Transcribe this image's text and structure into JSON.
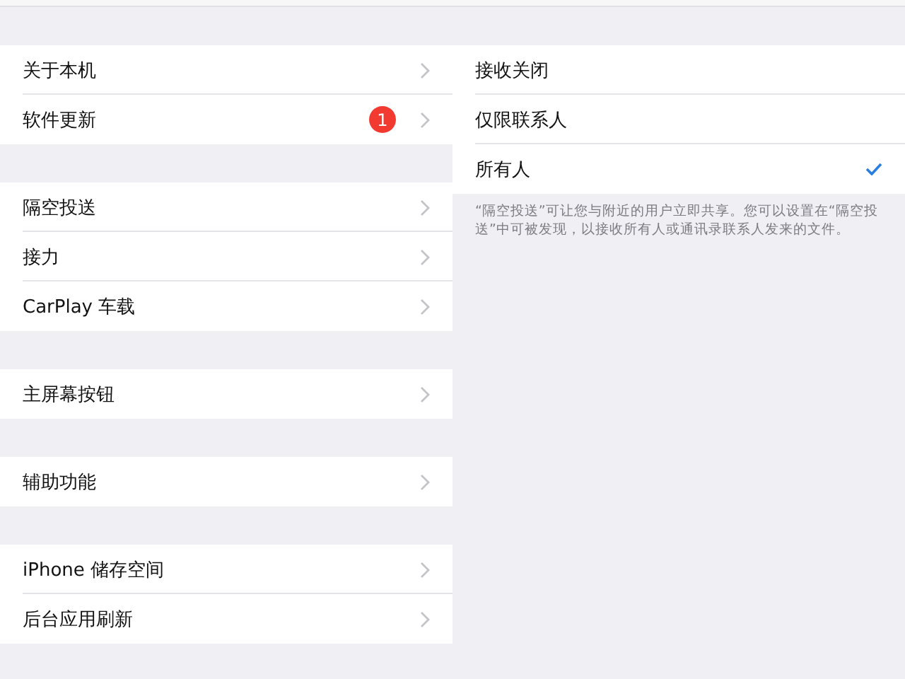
{
  "sidebar": {
    "groups": [
      {
        "items": [
          {
            "label": "关于本机"
          },
          {
            "label": "软件更新",
            "badge": "1"
          }
        ]
      },
      {
        "items": [
          {
            "label": "隔空投送"
          },
          {
            "label": "接力"
          },
          {
            "label": "CarPlay 车载"
          }
        ]
      },
      {
        "items": [
          {
            "label": "主屏幕按钮"
          }
        ]
      },
      {
        "items": [
          {
            "label": "辅助功能"
          }
        ]
      },
      {
        "items": [
          {
            "label": "iPhone 储存空间"
          },
          {
            "label": "后台应用刷新"
          }
        ]
      }
    ]
  },
  "detail": {
    "options": [
      {
        "label": "接收关闭",
        "selected": false
      },
      {
        "label": "仅限联系人",
        "selected": false
      },
      {
        "label": "所有人",
        "selected": true
      }
    ],
    "footer": "“隔空投送”可让您与附近的用户立即共享。您可以设置在“隔空投送”中可被发现，以接收所有人或通讯录联系人发来的文件。"
  }
}
